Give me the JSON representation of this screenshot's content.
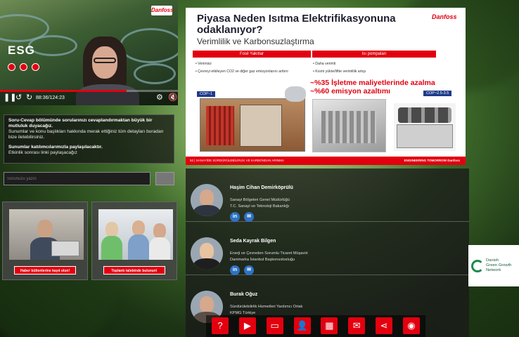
{
  "colors": {
    "accent": "#e2000f",
    "link": "#2d72c4",
    "dggn_green": "#1f8a4c"
  },
  "video": {
    "brand": "Danfoss",
    "overlay_title": "ESG",
    "time": "88:36/124:23",
    "progress": 0.71,
    "controls": {
      "play_pause": "pause-icon",
      "rewind": "rewind-10-icon",
      "forward": "forward-10-icon",
      "settings": "gear-icon",
      "mute": "mute-icon"
    }
  },
  "info": {
    "line1": "Soru-Cevap bölümünde sorularınızı cevaplandırmaktan büyük bir mutluluk duyacağız.",
    "line2": "Sunumlar ve konu başlıkları hakkında merak ettiğiniz tüm detayları buradan bize iletebilirsiniz.",
    "line3": "Sunumlar katılımcılarımızla paylaşılacaktır.",
    "line4": "Etkinlik sonrası linki paylaşacağız"
  },
  "question": {
    "placeholder": "Sorunuzu yazın",
    "submit": ""
  },
  "cards": [
    {
      "button": "Haber bültenlerine kayıt olun!"
    },
    {
      "button": "Toplantı talebinde bulunun!"
    }
  ],
  "slide": {
    "title": "Piyasa Neden Isıtma Elektrifikasyonuna odaklanıyor?",
    "subtitle": "Verimlilik ve Karbonsuzlaştırma",
    "brand": "Danfoss",
    "col_left": "Fosil Yakıtlar",
    "col_right": "Isı pompaları",
    "left_bullets": [
      "Verimsiz",
      "Çevreyi etkileyen CO2 ve diğer gaz emisyonlarını arttırır"
    ],
    "right_bullets": [
      "Daha verimli",
      "Kısmi yükte/liftte verimlilik artışı"
    ],
    "cop_left": "COP~1",
    "cop_right": "COP~2.5-3.5",
    "highlight1": "~%35 İşletme maliyetlerinde azalma",
    "highlight2": "~%60 emisyon azaltımı",
    "footer_left": "52  |  SANAYİDE SÜRDÜRÜLEBİLİRLİK VE KARBONDAN ARINMA",
    "footer_right": "ENGINEERING TOMORROW  Danfoss"
  },
  "speakers": [
    {
      "name": "Haşim Cihan Demirköprülü",
      "role1": "Sanayi Bölgeleri Genel Müdürlüğü",
      "role2": "T.C. Sanayi ve Teknoloji Bakanlığı",
      "suit": "#2e3440"
    },
    {
      "name": "Seda Kayrak Bilgen",
      "role1": "Enerji ve Çevreden Sorumlu Ticaret Müşaviri",
      "role2": "Danimarka İstanbul Başkonsolosluğu",
      "suit": "#1e1e1e"
    },
    {
      "name": "Burak Oğuz",
      "role1": "Sürdürülebilirlik Hizmetleri Yardımcı Ortak",
      "role2": "KPMG Türkiye",
      "suit": "#5a4f46"
    }
  ],
  "social": {
    "linkedin": "in",
    "mail": "✉"
  },
  "toolbar": [
    {
      "icon": "question-icon",
      "glyph": "?"
    },
    {
      "icon": "playlist-icon",
      "glyph": "▶"
    },
    {
      "icon": "presentation-icon",
      "glyph": "▭"
    },
    {
      "icon": "speaker-icon",
      "glyph": "👤"
    },
    {
      "icon": "calendar-icon",
      "glyph": "▦"
    },
    {
      "icon": "mail-icon",
      "glyph": "✉"
    },
    {
      "icon": "share-icon",
      "glyph": "⋖"
    },
    {
      "icon": "help-icon",
      "glyph": "◉"
    }
  ],
  "dggn": {
    "l1": "Danish",
    "l2": "Green Growth",
    "l3": "Network"
  }
}
